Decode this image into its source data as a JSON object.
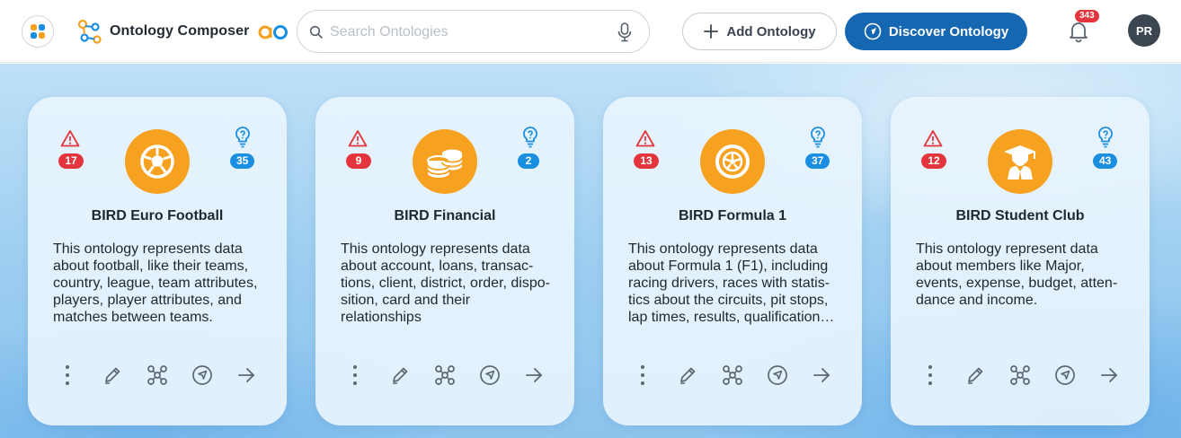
{
  "header": {
    "app_title": "Ontology Composer",
    "search_placeholder": "Search Ontologies",
    "add_button_label": "Add Ontology",
    "discover_button_label": "Discover Ontology",
    "notification_count": "343",
    "user_initials": "PR",
    "logo_text": "ao"
  },
  "colors": {
    "primary": "#1467b0",
    "emblem": "#f6a11f",
    "warning_badge": "#e5353c",
    "info_badge": "#1a8ee0"
  },
  "cards": [
    {
      "title": "BIRD Euro Football",
      "description": "This ontology represents data about football, like their teams, country, league, team attributes, players, player attributes, and matches between teams.",
      "warnings": "17",
      "suggestions": "35",
      "emblem_icon": "football-icon"
    },
    {
      "title": "BIRD Financial",
      "description": "This ontology represents data about account, loans, transac-tions, client, district, order, dispo-sition, card and their relationships",
      "warnings": "9",
      "suggestions": "2",
      "emblem_icon": "coins-icon"
    },
    {
      "title": "BIRD Formula 1",
      "description": "This ontology represents data about Formula 1 (F1), including racing drivers, races with statis-tics about the circuits, pit stops, lap times, results, qualification…",
      "warnings": "13",
      "suggestions": "37",
      "emblem_icon": "wheel-icon"
    },
    {
      "title": "BIRD Student Club",
      "description": "This ontology represent data about members like Major, events, expense, budget, atten-dance and income.",
      "warnings": "12",
      "suggestions": "43",
      "emblem_icon": "graduate-icon"
    }
  ]
}
